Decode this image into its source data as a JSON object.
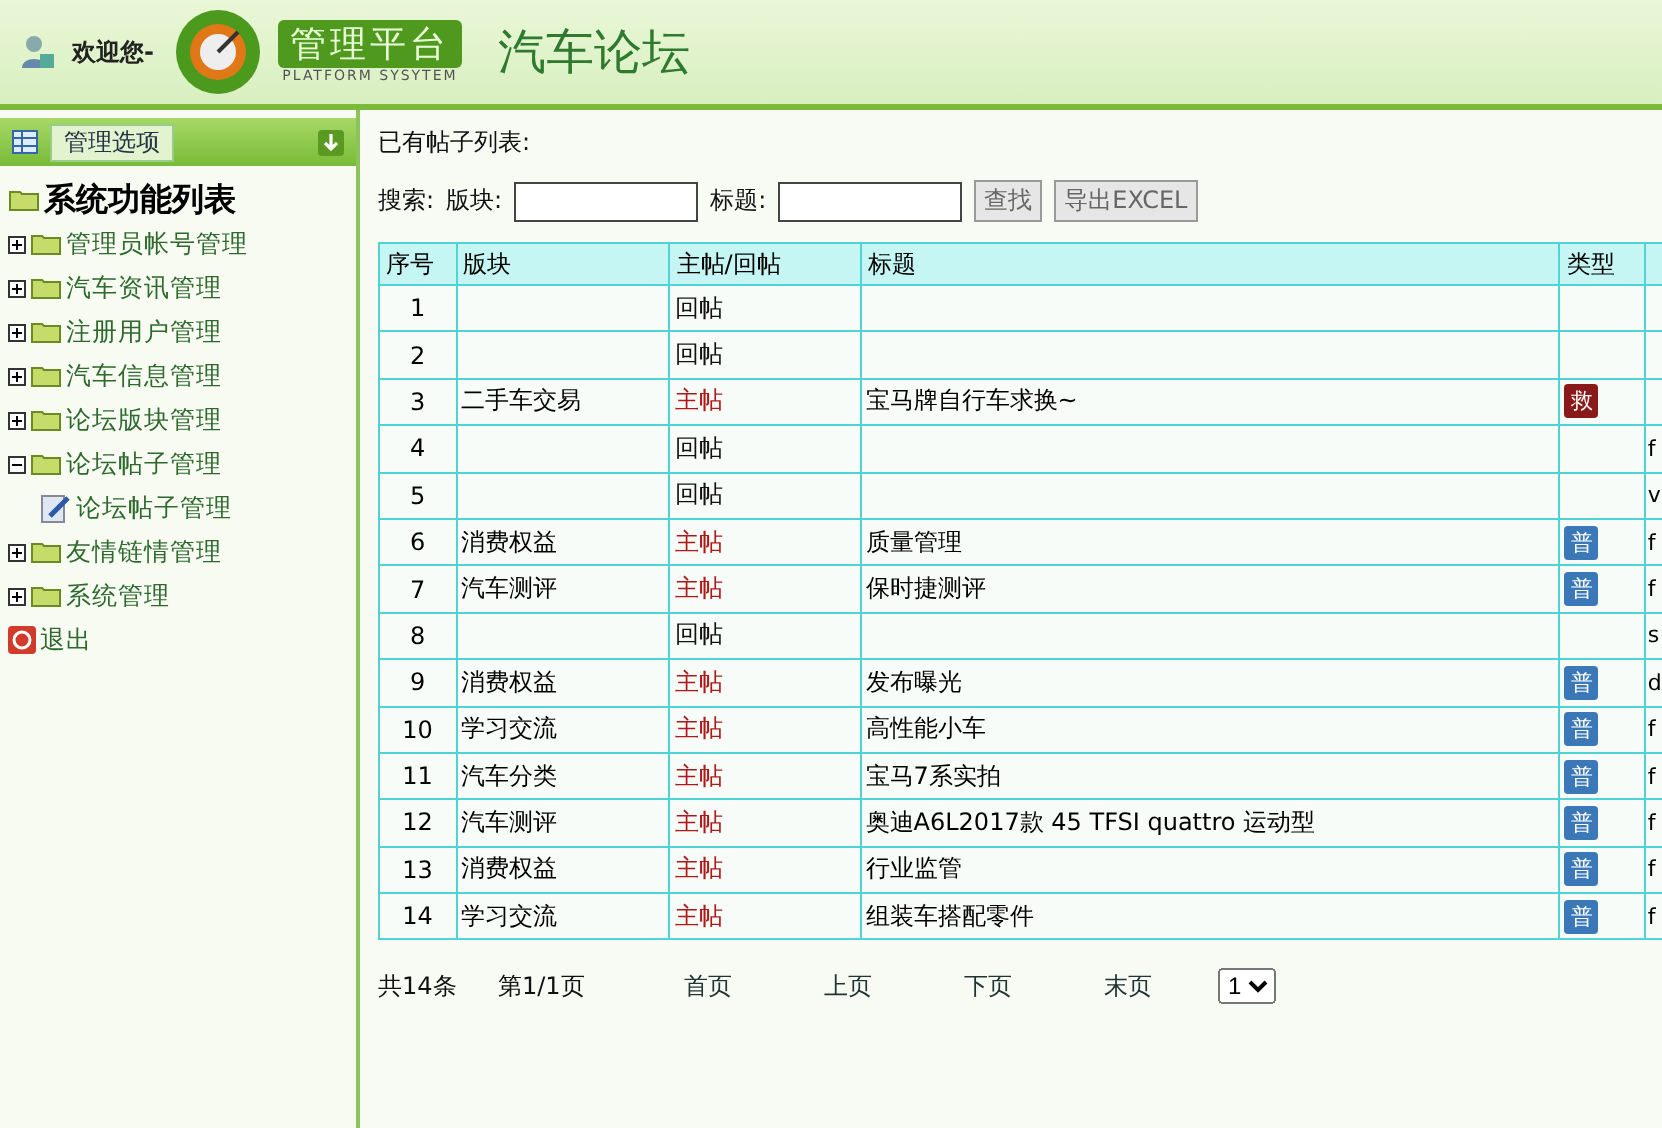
{
  "header": {
    "welcome": "欢迎您-",
    "logo_title": "管理平台",
    "logo_subtitle": "PLATFORM SYSYTEM",
    "title": "汽车论坛"
  },
  "sidebar": {
    "title": "管理选项",
    "tree_title": "系统功能列表",
    "items": [
      {
        "label": "管理员帐号管理",
        "kind": "folder",
        "expanded": false
      },
      {
        "label": "汽车资讯管理",
        "kind": "folder",
        "expanded": false
      },
      {
        "label": "注册用户管理",
        "kind": "folder",
        "expanded": false
      },
      {
        "label": "汽车信息管理",
        "kind": "folder",
        "expanded": false
      },
      {
        "label": "论坛版块管理",
        "kind": "folder",
        "expanded": false
      },
      {
        "label": "论坛帖子管理",
        "kind": "folder",
        "expanded": true,
        "children": [
          {
            "label": "论坛帖子管理",
            "kind": "page"
          }
        ]
      },
      {
        "label": "友情链情管理",
        "kind": "folder",
        "expanded": false
      },
      {
        "label": "系统管理",
        "kind": "folder",
        "expanded": false
      },
      {
        "label": "退出",
        "kind": "exit"
      }
    ]
  },
  "main": {
    "heading": "已有帖子列表:",
    "search": {
      "label": "搜索:",
      "section_label": "版块:",
      "title_label": "标题:",
      "buttons": [
        "查找",
        "导出EXCEL"
      ]
    },
    "table": {
      "columns": [
        "序号",
        "版块",
        "主帖/回帖",
        "标题",
        "类型",
        ""
      ],
      "rows": [
        {
          "no": "1",
          "section": "",
          "post": {
            "text": "回帖",
            "kind": "reply"
          },
          "title": "",
          "column_6": ""
        },
        {
          "no": "2",
          "section": "",
          "post": {
            "text": "回帖",
            "kind": "reply"
          },
          "title": "",
          "column_6": ""
        },
        {
          "no": "3",
          "section": "二手车交易",
          "post": {
            "text": "主帖",
            "kind": "main"
          },
          "title": "宝马牌自行车求换~",
          "type": {
            "text": "救",
            "kind": "urgent"
          },
          "column_6": ""
        },
        {
          "no": "4",
          "section": "",
          "post": {
            "text": "回帖",
            "kind": "reply"
          },
          "title": "",
          "column_6": "f"
        },
        {
          "no": "5",
          "section": "",
          "post": {
            "text": "回帖",
            "kind": "reply"
          },
          "title": "",
          "column_6": "v"
        },
        {
          "no": "6",
          "section": "消费权益",
          "post": {
            "text": "主帖",
            "kind": "main"
          },
          "title": "质量管理",
          "type": {
            "text": "普",
            "kind": "normal"
          },
          "column_6": "f"
        },
        {
          "no": "7",
          "section": "汽车测评",
          "post": {
            "text": "主帖",
            "kind": "main"
          },
          "title": "保时捷测评",
          "type": {
            "text": "普",
            "kind": "normal"
          },
          "column_6": "f"
        },
        {
          "no": "8",
          "section": "",
          "post": {
            "text": "回帖",
            "kind": "reply"
          },
          "title": "",
          "column_6": "s"
        },
        {
          "no": "9",
          "section": "消费权益",
          "post": {
            "text": "主帖",
            "kind": "main"
          },
          "title": "发布曝光",
          "type": {
            "text": "普",
            "kind": "normal"
          },
          "column_6": "d"
        },
        {
          "no": "10",
          "section": "学习交流",
          "post": {
            "text": "主帖",
            "kind": "main"
          },
          "title": "高性能小车",
          "type": {
            "text": "普",
            "kind": "normal"
          },
          "column_6": "f"
        },
        {
          "no": "11",
          "section": "汽车分类",
          "post": {
            "text": "主帖",
            "kind": "main"
          },
          "title": "宝马7系实拍",
          "type": {
            "text": "普",
            "kind": "normal"
          },
          "column_6": "f"
        },
        {
          "no": "12",
          "section": "汽车测评",
          "post": {
            "text": "主帖",
            "kind": "main"
          },
          "title": "奥迪A6L2017款 45 TFSI quattro 运动型",
          "type": {
            "text": "普",
            "kind": "normal"
          },
          "column_6": "f"
        },
        {
          "no": "13",
          "section": "消费权益",
          "post": {
            "text": "主帖",
            "kind": "main"
          },
          "title": "行业监管",
          "type": {
            "text": "普",
            "kind": "normal"
          },
          "column_6": "f"
        },
        {
          "no": "14",
          "section": "学习交流",
          "post": {
            "text": "主帖",
            "kind": "main"
          },
          "title": "组装车搭配零件",
          "type": {
            "text": "普",
            "kind": "normal"
          },
          "column_6": "f"
        }
      ]
    },
    "pager": {
      "total": "共14条",
      "page": "第1/1页",
      "links": [
        "首页",
        "上页",
        "下页",
        "末页"
      ],
      "select": "1"
    }
  }
}
